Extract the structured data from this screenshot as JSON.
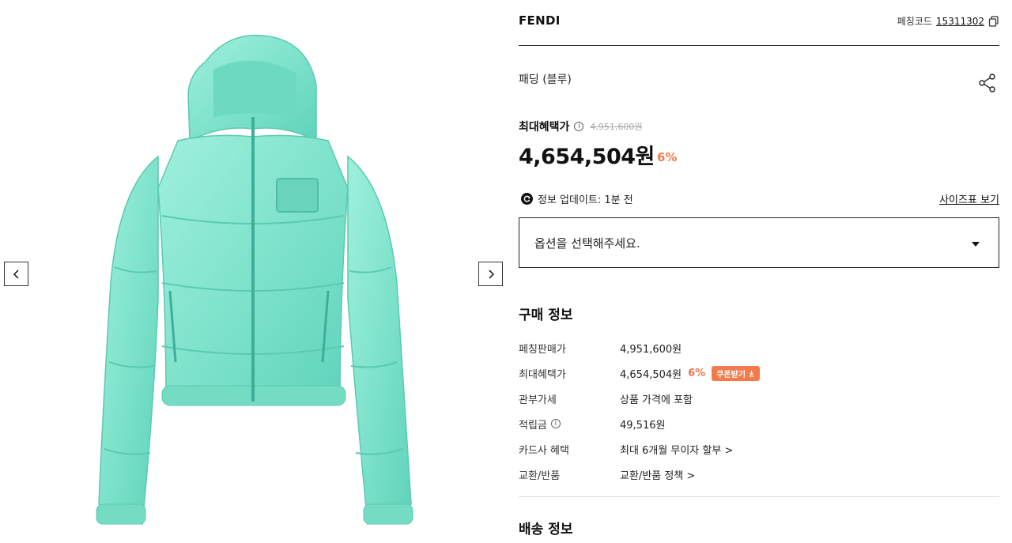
{
  "gallery": {
    "prev_glyph": "‹",
    "next_glyph": "›",
    "image_desc": "mint-puffer-jacket"
  },
  "header": {
    "brand": "FENDI",
    "code_label": "페칭코드",
    "code_value": "15311302"
  },
  "product": {
    "name": "패딩 (블루)"
  },
  "price": {
    "max_label": "최대혜택가",
    "original": "4,951,600원",
    "final": "4,654,504원",
    "discount": "6%"
  },
  "update": {
    "text": "정보 업데이트: 1분 전",
    "size_chart": "사이즈표 보기"
  },
  "option": {
    "placeholder": "옵션을 선택해주세요."
  },
  "purchase": {
    "title": "구매 정보",
    "rows": [
      {
        "key": "페칭판매가",
        "value": "4,951,600원"
      },
      {
        "key": "최대혜택가",
        "value": "4,654,504원",
        "discount": "6%",
        "coupon": "쿠폰받기"
      },
      {
        "key": "관부가세",
        "value": "상품 가격에 포함"
      },
      {
        "key": "적립금",
        "value": "49,516원"
      },
      {
        "key": "카드사 혜택",
        "value": "최대 6개월 무이자 할부 >"
      },
      {
        "key": "교환/반품",
        "value": "교환/반품 정책 >"
      }
    ]
  },
  "shipping": {
    "title": "배송 정보"
  },
  "colors": {
    "accent": "#f27a4b",
    "jacket": "#7fe3cc"
  }
}
